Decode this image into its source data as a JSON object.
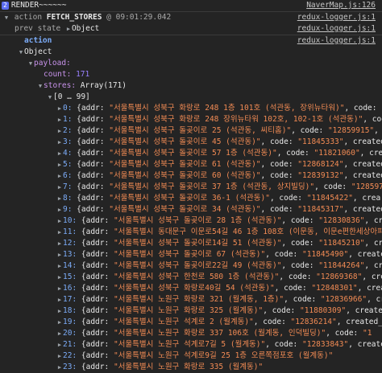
{
  "console": {
    "render_badge": "2",
    "render_text": "RENDER~~~~~~",
    "render_src": "NaverMap.js:126",
    "action_prefix": "action",
    "action_name": "FETCH_STORES",
    "action_time": "@ 09:01:29.042",
    "action_src": "redux-logger.js:1",
    "prev_label": "prev state",
    "prev_value": "Object",
    "prev_src": "redux-logger.js:1",
    "action_label": "action",
    "action_label_src": "redux-logger.js:1",
    "object_label": "Object",
    "payload_key": "payload:",
    "count_key": "count:",
    "count_value": "171",
    "stores_key": "stores:",
    "stores_value": "Array(171)",
    "range_label": "[0 … 99]"
  },
  "rows": [
    {
      "idx": "0:",
      "addr": "\"서울특별시 성북구 화랑로 248 1층 101호 (석관동, 장위뉴타워)\"",
      "code": "\"12"
    },
    {
      "idx": "1:",
      "addr": "\"서울특별시 성북구 화랑로 248 장위뉴타워 102호, 102-1호 (석관동)\"",
      "code": "\""
    },
    {
      "idx": "2:",
      "addr": "\"서울특별시 성북구 돌곶이로 25 (석관동, 씨티홈)\"",
      "code": "\"12859915\"",
      "tail": ", cre"
    },
    {
      "idx": "3:",
      "addr": "\"서울특별시 성북구 돌곶이로 45 (석관동)\"",
      "code": "\"11845333\"",
      "tail": ", created_"
    },
    {
      "idx": "4:",
      "addr": "\"서울특별시 성북구 돌곶이로 57 1층 (석관동)\"",
      "code": "\"11821060\"",
      "tail": ", create"
    },
    {
      "idx": "5:",
      "addr": "\"서울특별시 성북구 돌곶이로 61 (석관동)\"",
      "code": "\"12868124\"",
      "tail": ", created_"
    },
    {
      "idx": "6:",
      "addr": "\"서울특별시 성북구 돌곶이로 60 (석관동)\"",
      "code": "\"12839132\"",
      "tail": ", created_"
    },
    {
      "idx": "7:",
      "addr": "\"서울특별시 성북구 돌곶이로 37 1층 (석관동, 상지빌딩)\"",
      "code": "\"1285977",
      "tail": ""
    },
    {
      "idx": "8:",
      "addr": "\"서울특별시 성북구 돌곶이로 36-1 (석관동)\"",
      "code": "\"11845422\"",
      "tail": ", crea"
    },
    {
      "idx": "9:",
      "addr": "\"서울특별시 성북구 돌곶이로 34 (석관동)\"",
      "code": "\"11845317\"",
      "tail": ", created_"
    },
    {
      "idx": "10:",
      "addr": "\"서울특별시 성북구 돌곶이로 28 1층 (석관동)\"",
      "code": "\"12830836\"",
      "tail": ", cre"
    },
    {
      "idx": "11:",
      "addr": "\"서울특별시 동대문구 이문로54길 46 1층 108호 (이문동, 이문e편한세상아파트상",
      "code": "",
      "tail": ""
    },
    {
      "idx": "12:",
      "addr": "\"서울특별시 성북구 돌곶이로14길 51 (석관동)\"",
      "code": "\"11845210\"",
      "tail": ", cre"
    },
    {
      "idx": "13:",
      "addr": "\"서울특별시 성북구 돌곶이로 67 (석관동)\"",
      "code": "\"11845490\"",
      "tail": ", created_"
    },
    {
      "idx": "14:",
      "addr": "\"서울특별시 성북구 돌곶이로22길 49 (석관동)\"",
      "code": "\"11844264\"",
      "tail": ", creat"
    },
    {
      "idx": "15:",
      "addr": "\"서울특별시 성북구 한천로 580 1층 (석관동)\"",
      "code": "\"12869368\"",
      "tail": ", creat"
    },
    {
      "idx": "16:",
      "addr": "\"서울특별시 성북구 화랑로40길 54 (석관동)\"",
      "code": "\"12848301\"",
      "tail": ", create"
    },
    {
      "idx": "17:",
      "addr": "\"서울특별시 노원구 화랑로 321 (월계동, 1층)\"",
      "code": "\"12836966\"",
      "tail": ", cr"
    },
    {
      "idx": "18:",
      "addr": "\"서울특별시 노원구 화랑로 325 (월계동)\"",
      "code": "\"11880309\"",
      "tail": ", created_"
    },
    {
      "idx": "19:",
      "addr": "\"서울특별시 노원구 석계로 2 (월계동)\"",
      "code": "\"12836214\"",
      "tail": ", created_at"
    },
    {
      "idx": "20:",
      "addr": "\"서울특별시 노원구 화랑로 337 106호 (월계동, 인덕빌딩)\"",
      "code": "\"1",
      "tail": ""
    },
    {
      "idx": "21:",
      "addr": "\"서울특별시 노원구 석계로7길 5 (월계동)\"",
      "code": "\"12833843\"",
      "tail": ", created_"
    },
    {
      "idx": "22:",
      "addr": "\"서울특별시 노원구 석계로9길 25 1층 오른쪽점포호 (월계동)\"",
      "code": "",
      "tail": ""
    },
    {
      "idx": "23:",
      "addr": "\"서울특별시 노원구 화랑로 335 (월계동)\"",
      "code": "",
      "tail": ""
    }
  ],
  "row_strings": {
    "open_brace": "{addr: ",
    "code_key": ", code: "
  }
}
